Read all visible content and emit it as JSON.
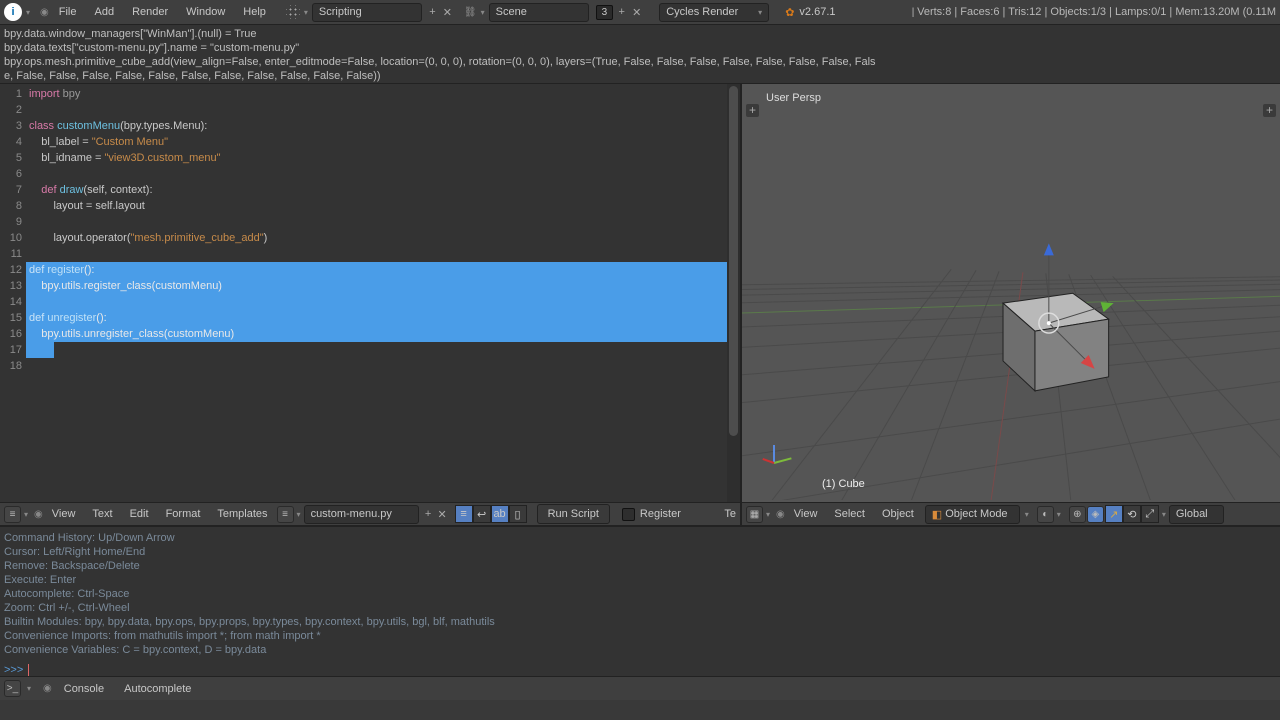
{
  "top_menu": {
    "items": [
      "File",
      "Add",
      "Render",
      "Window",
      "Help"
    ],
    "layout_dd": "Scripting",
    "scene_dd": "Scene",
    "scene_num": "3",
    "engine_dd": "Cycles Render",
    "version": "v2.67.1",
    "stats": "Verts:8 | Faces:6 | Tris:12 | Objects:1/3 | Lamps:0/1 | Mem:13.20M (0.11M"
  },
  "info_lines": [
    "bpy.data.window_managers[\"WinMan\"].(null) = True",
    "bpy.data.texts[\"custom-menu.py\"].name = \"custom-menu.py\"",
    "bpy.ops.mesh.primitive_cube_add(view_align=False, enter_editmode=False, location=(0, 0, 0), rotation=(0, 0, 0), layers=(True, False, False, False, False, False, False, False, Fals",
    "e, False, False, False, False, False, False, False, False, False, False, False))"
  ],
  "editor": {
    "lines": [
      {
        "n": 1,
        "segs": [
          {
            "t": "import ",
            "c": "k-import"
          },
          {
            "t": "bpy",
            "c": "k-mod"
          }
        ]
      },
      {
        "n": 2,
        "segs": []
      },
      {
        "n": 3,
        "segs": [
          {
            "t": "class ",
            "c": "k-kw"
          },
          {
            "t": "customMenu",
            "c": "k-cls"
          },
          {
            "t": "(bpy.types.Menu):",
            "c": ""
          }
        ]
      },
      {
        "n": 4,
        "segs": [
          {
            "t": "    bl_label = ",
            "c": ""
          },
          {
            "t": "\"Custom Menu\"",
            "c": "k-str"
          }
        ]
      },
      {
        "n": 5,
        "segs": [
          {
            "t": "    bl_idname = ",
            "c": ""
          },
          {
            "t": "\"view3D.custom_menu\"",
            "c": "k-str"
          }
        ]
      },
      {
        "n": 6,
        "segs": []
      },
      {
        "n": 7,
        "segs": [
          {
            "t": "    def ",
            "c": "k-kw"
          },
          {
            "t": "draw",
            "c": "k-fn"
          },
          {
            "t": "(self, context):",
            "c": ""
          }
        ]
      },
      {
        "n": 8,
        "segs": [
          {
            "t": "        layout = self.layout",
            "c": ""
          }
        ]
      },
      {
        "n": 9,
        "segs": []
      },
      {
        "n": 10,
        "segs": [
          {
            "t": "        layout.operator(",
            "c": ""
          },
          {
            "t": "\"mesh.primitive_cube_add\"",
            "c": "k-str"
          },
          {
            "t": ")",
            "c": ""
          }
        ]
      },
      {
        "n": 11,
        "segs": []
      },
      {
        "n": 12,
        "sel": true,
        "segs": [
          {
            "t": "def ",
            "c": "k-kw2"
          },
          {
            "t": "register",
            "c": "k-fn2"
          },
          {
            "t": "():",
            "c": ""
          }
        ]
      },
      {
        "n": 13,
        "sel": true,
        "segs": [
          {
            "t": "    bpy.utils.register_class(customMenu)",
            "c": ""
          }
        ]
      },
      {
        "n": 14,
        "sel": true,
        "segs": []
      },
      {
        "n": 15,
        "sel": true,
        "segs": [
          {
            "t": "def ",
            "c": "k-kw2"
          },
          {
            "t": "unregister",
            "c": "k-fn2"
          },
          {
            "t": "():",
            "c": ""
          }
        ]
      },
      {
        "n": 16,
        "sel": true,
        "segs": [
          {
            "t": "    bpy.utils.unregister_class(customMenu)",
            "c": ""
          }
        ]
      },
      {
        "n": 17,
        "sel": true,
        "half": true,
        "segs": []
      },
      {
        "n": 18,
        "segs": []
      }
    ]
  },
  "viewport": {
    "label": "User Persp",
    "object": "(1) Cube"
  },
  "text_hdr": {
    "menus": [
      "View",
      "Text",
      "Edit",
      "Format",
      "Templates"
    ],
    "file": "custom-menu.py",
    "run": "Run Script",
    "register": "Register",
    "cutoff": "Te"
  },
  "vp_hdr": {
    "menus": [
      "View",
      "Select",
      "Object"
    ],
    "mode": "Object Mode",
    "orient": "Global"
  },
  "console": {
    "lines": [
      "Command History:     Up/Down Arrow",
      "Cursor:              Left/Right Home/End",
      "Remove:              Backspace/Delete",
      "Execute:             Enter",
      "Autocomplete:        Ctrl-Space",
      "Zoom:                Ctrl +/-, Ctrl-Wheel",
      "Builtin Modules:     bpy, bpy.data, bpy.ops, bpy.props, bpy.types, bpy.context, bpy.utils, bgl, blf, mathutils",
      "Convenience Imports: from mathutils import *; from math import *",
      "Convenience Variables: C = bpy.context, D = bpy.data"
    ],
    "prompt": ">>> "
  },
  "console_foot": {
    "menus": [
      "Console",
      "Autocomplete"
    ]
  }
}
